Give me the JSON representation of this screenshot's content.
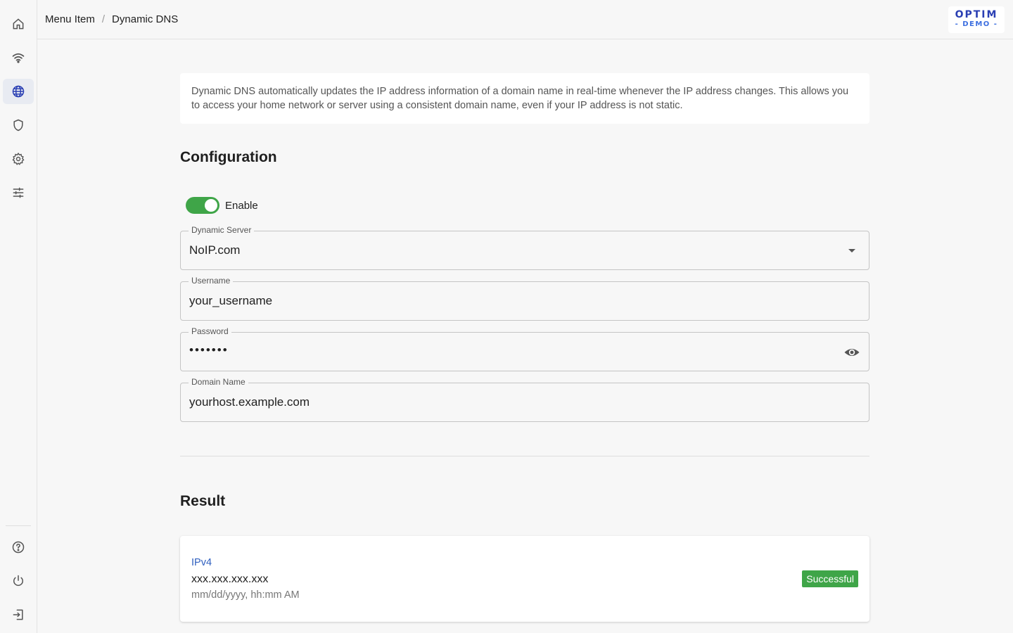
{
  "breadcrumb": {
    "parent": "Menu Item",
    "separator": "/",
    "current": "Dynamic DNS"
  },
  "logo": {
    "line1": "OPTIM",
    "line2": "- DEMO -"
  },
  "sidebar": {
    "items": [
      {
        "name": "home",
        "icon": "home-icon"
      },
      {
        "name": "wifi",
        "icon": "wifi-icon"
      },
      {
        "name": "internet",
        "icon": "globe-icon",
        "active": true
      },
      {
        "name": "security",
        "icon": "shield-icon"
      },
      {
        "name": "settings",
        "icon": "gear-icon"
      },
      {
        "name": "advanced",
        "icon": "sliders-icon"
      }
    ],
    "bottom": [
      {
        "name": "help",
        "icon": "help-icon"
      },
      {
        "name": "power",
        "icon": "power-icon"
      },
      {
        "name": "logout",
        "icon": "logout-icon"
      }
    ]
  },
  "info_text": "Dynamic DNS automatically updates the IP address information of a domain name in real-time whenever the IP address changes. This allows you to access your home network or server using a consistent domain name, even if your IP address is not static.",
  "configuration": {
    "title": "Configuration",
    "enable_label": "Enable",
    "enabled": true,
    "fields": {
      "server": {
        "label": "Dynamic Server",
        "value": "NoIP.com"
      },
      "username": {
        "label": "Username",
        "value": "your_username"
      },
      "password": {
        "label": "Password",
        "value": "•••••••"
      },
      "domain": {
        "label": "Domain Name",
        "value": "yourhost.example.com"
      }
    }
  },
  "result": {
    "title": "Result",
    "type": "IPv4",
    "ip": "xxx.xxx.xxx.xxx",
    "time": "mm/dd/yyyy, hh:mm AM",
    "status": "Successful"
  },
  "colors": {
    "accent": "#3fa548",
    "brand": "#2a3fb3",
    "link": "#2f5fbf"
  }
}
